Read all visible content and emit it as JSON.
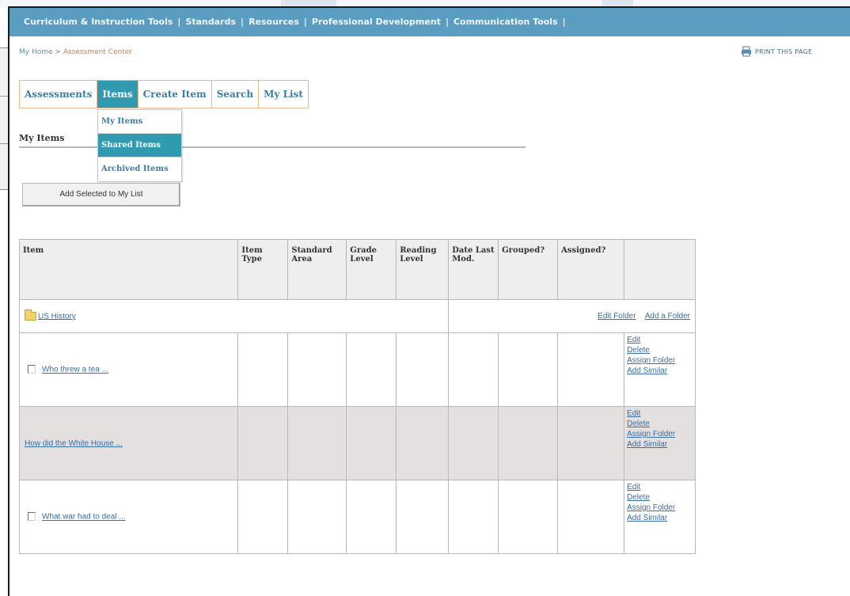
{
  "topnav": {
    "items": [
      "Curriculum & Instruction Tools",
      "Standards",
      "Resources",
      "Professional Development",
      "Communication Tools"
    ],
    "separator": "|"
  },
  "breadcrumb": {
    "home": "My Home",
    "sep": ">",
    "current": "Assessment Center"
  },
  "print_label": "PRINT THIS PAGE",
  "tabs": [
    "Assessments",
    "Items",
    "Create Item",
    "Search",
    "My List"
  ],
  "active_tab": "Items",
  "dropdown": {
    "items": [
      "My Items",
      "Shared Items",
      "Archived Items"
    ],
    "active": "Shared Items"
  },
  "section_title": "My Items",
  "add_button_label": "Add Selected to My List",
  "table": {
    "headers": [
      "Item",
      "Item Type",
      "Standard Area",
      "Grade Level",
      "Reading Level",
      "Date Last Mod.",
      "Grouped?",
      "Assigned?",
      ""
    ],
    "folder": {
      "name": "US History",
      "edit_label": "Edit Folder",
      "add_label": "Add a Folder"
    },
    "actions": [
      "Edit",
      "Delete",
      "Assign Folder",
      "Add Similar"
    ],
    "rows": [
      {
        "text": "Who threw a tea ...",
        "has_checkbox": true
      },
      {
        "text": "How did the White House ...",
        "has_checkbox": false
      },
      {
        "text": "What war had to deal ...",
        "has_checkbox": true
      }
    ]
  },
  "colors": {
    "nav_bg": "#5a9dc0",
    "tab_active": "#2f9ab0",
    "tab_border": "#e6b98e",
    "breadcrumb_current": "#e07a3b",
    "row_shade": "#e3e0df"
  }
}
